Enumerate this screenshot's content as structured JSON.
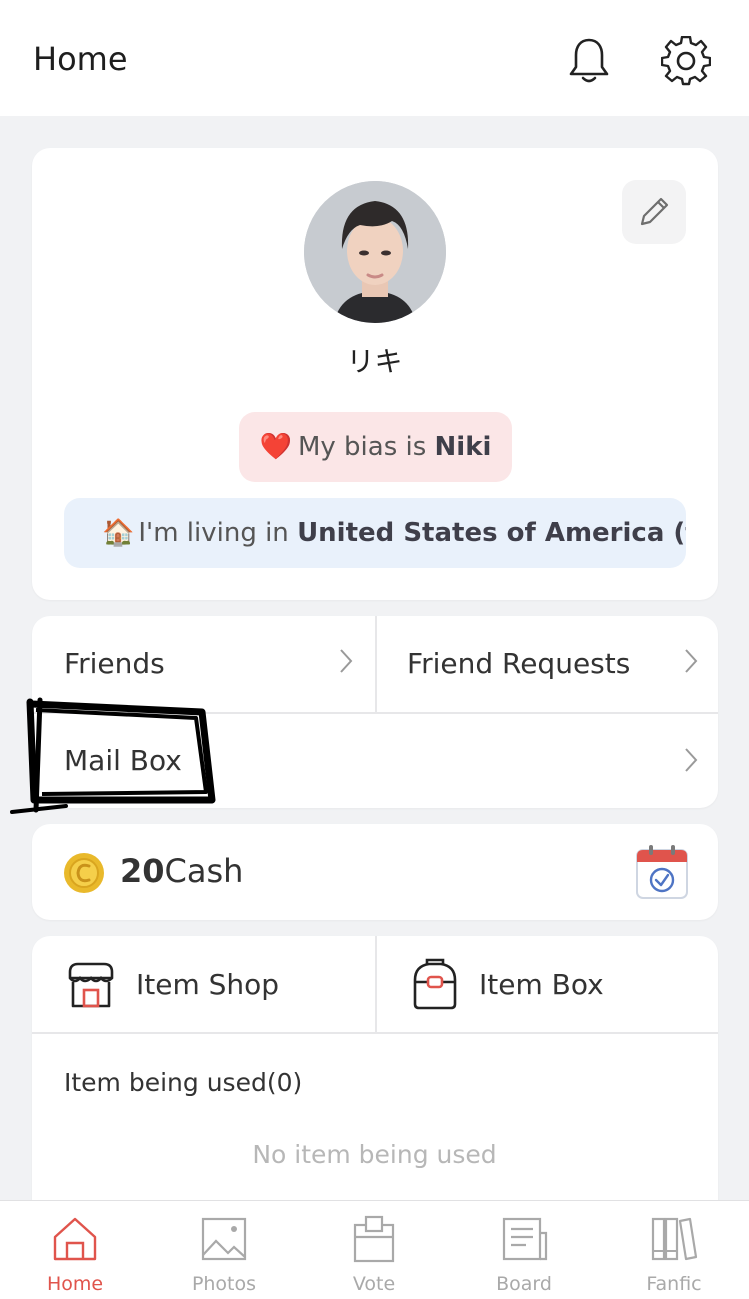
{
  "header": {
    "title": "Home",
    "icons": [
      "bell-icon",
      "gear-icon"
    ]
  },
  "profile": {
    "name": "リキ",
    "bias_prefix": "My bias is ",
    "bias_name": "Niki",
    "bias_emoji": "❤️",
    "living_emoji": "🏠",
    "living_prefix": "I'm living in ",
    "living_place": "United States of America (t…",
    "edit_icon": "pencil-icon"
  },
  "friends": {
    "friends_label": "Friends",
    "requests_label": "Friend Requests",
    "mailbox_label": "Mail Box"
  },
  "cash": {
    "amount": "20",
    "unit": "Cash",
    "coin_icon": "coin-icon",
    "calendar_icon": "calendar-check-icon"
  },
  "items": {
    "shop_label": "Item Shop",
    "box_label": "Item Box",
    "used_label": "Item being used(0)",
    "empty_text": "No item being used"
  },
  "nav": {
    "items": [
      {
        "label": "Home",
        "icon": "home-icon",
        "active": true
      },
      {
        "label": "Photos",
        "icon": "photo-icon",
        "active": false
      },
      {
        "label": "Vote",
        "icon": "vote-icon",
        "active": false
      },
      {
        "label": "Board",
        "icon": "board-icon",
        "active": false
      },
      {
        "label": "Fanfic",
        "icon": "books-icon",
        "active": false
      }
    ]
  },
  "colors": {
    "accent": "#e0544c",
    "bias_bg": "#fbe6e7",
    "living_bg": "#e9f1fb",
    "page_bg": "#f1f2f4"
  }
}
